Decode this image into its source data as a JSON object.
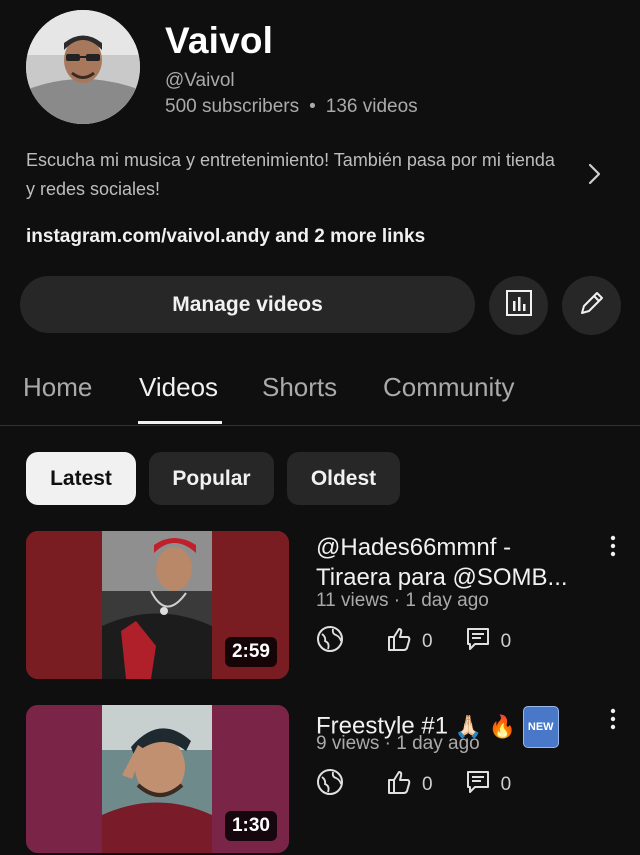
{
  "channel": {
    "name": "Vaivol",
    "handle": "@Vaivol",
    "subscribers": "500 subscribers",
    "videos_count": "136 videos",
    "separator": "•",
    "description": "Escucha mi musica y entretenimiento! También pasa por mi tienda y redes sociales!",
    "links": "instagram.com/vaivol.andy and 2 more links"
  },
  "actions": {
    "manage_label": "Manage videos",
    "analytics_icon": "bar-chart-icon",
    "edit_icon": "pencil-icon"
  },
  "tabs": [
    {
      "label": "Home",
      "active": false
    },
    {
      "label": "Videos",
      "active": true
    },
    {
      "label": "Shorts",
      "active": false
    },
    {
      "label": "Community",
      "active": false
    }
  ],
  "filters": [
    {
      "label": "Latest",
      "selected": true
    },
    {
      "label": "Popular",
      "selected": false
    },
    {
      "label": "Oldest",
      "selected": false
    }
  ],
  "videos": [
    {
      "title": "@Hades66mmnf - Tiraera para @SOMB...",
      "meta": "11 views · 1 day ago",
      "duration": "2:59",
      "likes": "0",
      "comments": "0",
      "thumb_color": "#7a1d22"
    },
    {
      "title": "Freestyle #1",
      "title_emojis": [
        "🙏🏻",
        "🔥"
      ],
      "title_badge": "NEW",
      "meta": "9 views · 1 day ago",
      "duration": "1:30",
      "likes": "0",
      "comments": "0",
      "thumb_color": "#7a2548"
    }
  ]
}
